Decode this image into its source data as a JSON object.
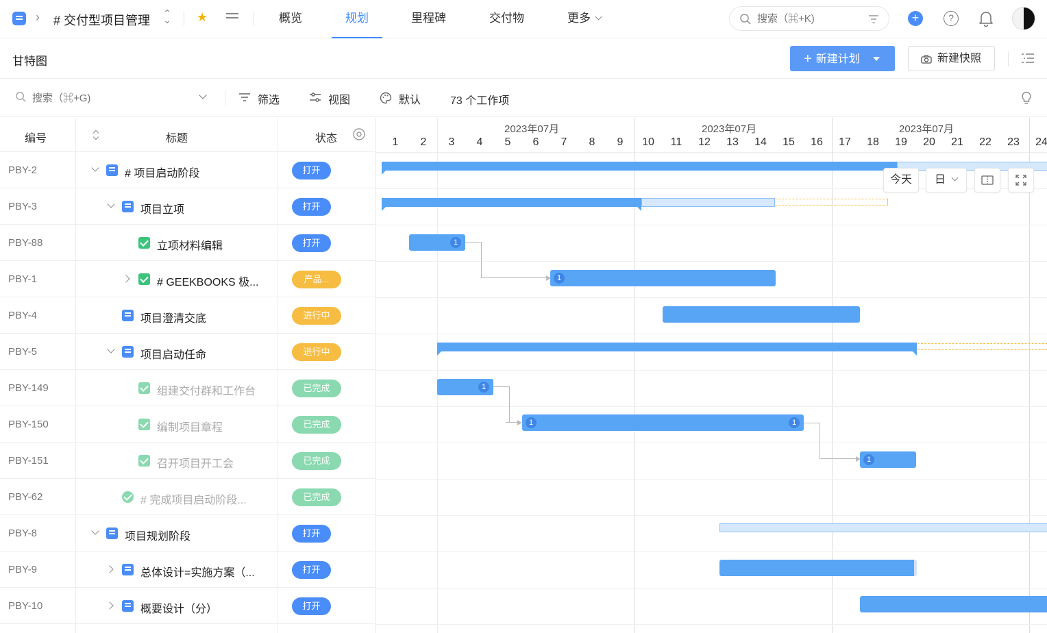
{
  "topbar": {
    "project_title": "# 交付型项目管理",
    "tabs": [
      {
        "label": "概览"
      },
      {
        "label": "规划"
      },
      {
        "label": "里程碑"
      },
      {
        "label": "交付物"
      },
      {
        "label": "更多"
      }
    ],
    "active_tab": "规划",
    "search_placeholder": "搜索（⌘+K)"
  },
  "subheader": {
    "title": "甘特图",
    "new_plan_label": "新建计划",
    "new_snapshot_label": "新建快照"
  },
  "toolbar": {
    "search_placeholder": "搜索（⌘+G)",
    "filter_label": "筛选",
    "view_label": "视图",
    "theme_label": "默认",
    "count_label": "73 个工作项"
  },
  "table": {
    "headers": {
      "id": "编号",
      "title": "标题",
      "status": "状态"
    },
    "rows": [
      {
        "id": "PBY-2",
        "title": "# 项目启动阶段",
        "status": "打开"
      },
      {
        "id": "PBY-3",
        "title": "项目立项",
        "status": "打开"
      },
      {
        "id": "PBY-88",
        "title": "立项材料编辑",
        "status": "打开"
      },
      {
        "id": "PBY-1",
        "title": "# GEEKBOOKS 极...",
        "status": "产品..."
      },
      {
        "id": "PBY-4",
        "title": "项目澄清交底",
        "status": "进行中"
      },
      {
        "id": "PBY-5",
        "title": "项目启动任命",
        "status": "进行中"
      },
      {
        "id": "PBY-149",
        "title": "组建交付群和工作台",
        "status": "已完成"
      },
      {
        "id": "PBY-150",
        "title": "编制项目章程",
        "status": "已完成"
      },
      {
        "id": "PBY-151",
        "title": "召开项目开工会",
        "status": "已完成"
      },
      {
        "id": "PBY-62",
        "title": "# 完成项目启动阶段...",
        "status": "已完成"
      },
      {
        "id": "PBY-8",
        "title": "项目规划阶段",
        "status": "打开"
      },
      {
        "id": "PBY-9",
        "title": "总体设计=实施方案（...",
        "status": "打开"
      },
      {
        "id": "PBY-10",
        "title": "概要设计（分）",
        "status": "打开"
      }
    ]
  },
  "gantt": {
    "months": [
      "2023年07月",
      "2023年07月",
      "2023年07月"
    ],
    "days": [
      "1",
      "2",
      "3",
      "4",
      "5",
      "6",
      "7",
      "8",
      "9",
      "10",
      "11",
      "12",
      "13",
      "14",
      "15",
      "16",
      "17",
      "18",
      "19",
      "20",
      "21",
      "22",
      "23",
      "24"
    ],
    "today_label": "今天",
    "scale_label": "日",
    "dep_label": "1"
  },
  "colors": {
    "accent": "#4a8df8",
    "bar": "#58a5f6",
    "in_progress": "#f6bd42",
    "done": "#8ad9b0",
    "check": "#3cc47c"
  }
}
